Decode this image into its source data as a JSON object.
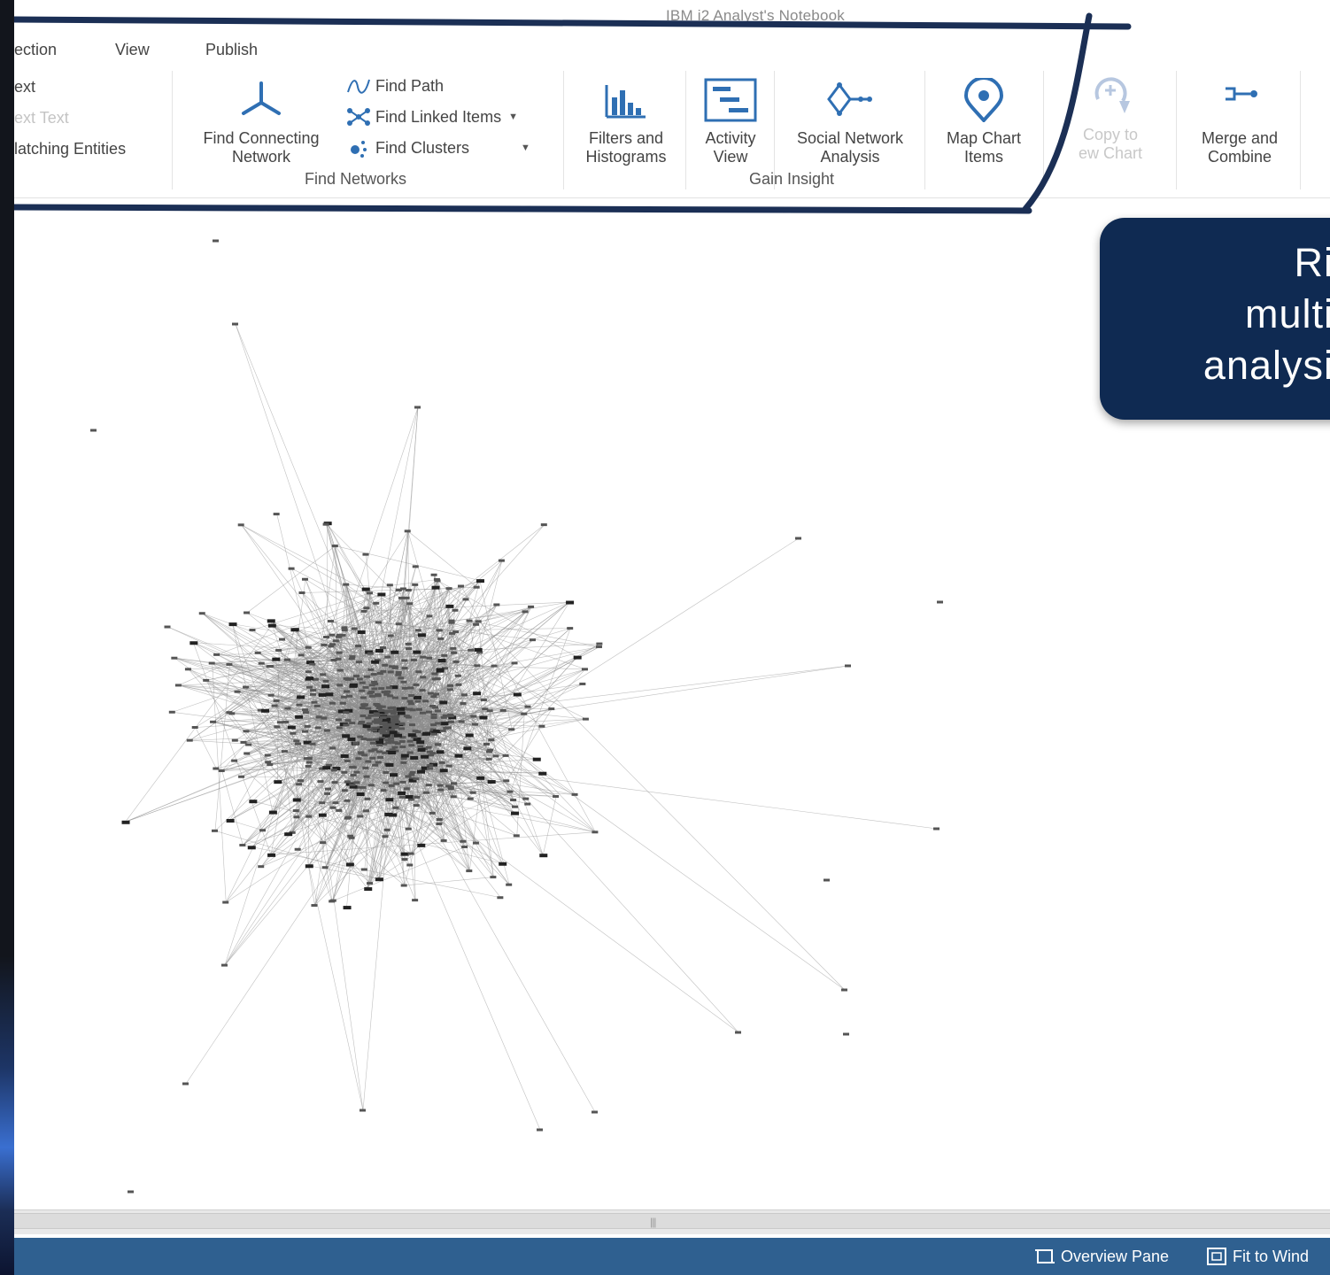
{
  "window": {
    "title": "IBM i2 Analyst's Notebook"
  },
  "tabs": [
    {
      "label": "ection"
    },
    {
      "label": "View"
    },
    {
      "label": "Publish"
    }
  ],
  "ribbon": {
    "text_group": {
      "item1": "ext",
      "item2": "ext Text",
      "item3": "latching Entities"
    },
    "find_networks": {
      "label": "Find Networks",
      "find_connecting_network": "Find Connecting\nNetwork",
      "find_path": "Find Path",
      "find_linked_items": "Find Linked Items",
      "find_clusters": "Find Clusters"
    },
    "gain_insight": {
      "label": "Gain Insight",
      "filters_histograms": "Filters and\nHistograms",
      "activity_view": "Activity\nView",
      "social_network_analysis": "Social Network\nAnalysis",
      "map_chart_items": "Map Chart\nItems"
    },
    "copy_to_new_chart": "Copy to\new Chart",
    "merge_and_combine": "Merge and\nCombine"
  },
  "callout": {
    "text": "Ri\nmulti\nanalysi"
  },
  "statusbar": {
    "overview_pane": "Overview Pane",
    "fit_to_window": "Fit to Wind"
  },
  "colors": {
    "status_bar": "#2f6090",
    "callout_bg": "#0f2a52",
    "annotation_stroke": "#1b2f55",
    "icon_blue": "#2f6fb3"
  },
  "icons": [
    "find-connecting-network-icon",
    "find-path-icon",
    "find-linked-items-icon",
    "find-clusters-icon",
    "filters-histograms-icon",
    "activity-view-icon",
    "social-network-icon",
    "map-pin-icon",
    "copy-chart-icon",
    "merge-combine-icon",
    "overview-pane-icon",
    "fit-window-icon"
  ]
}
